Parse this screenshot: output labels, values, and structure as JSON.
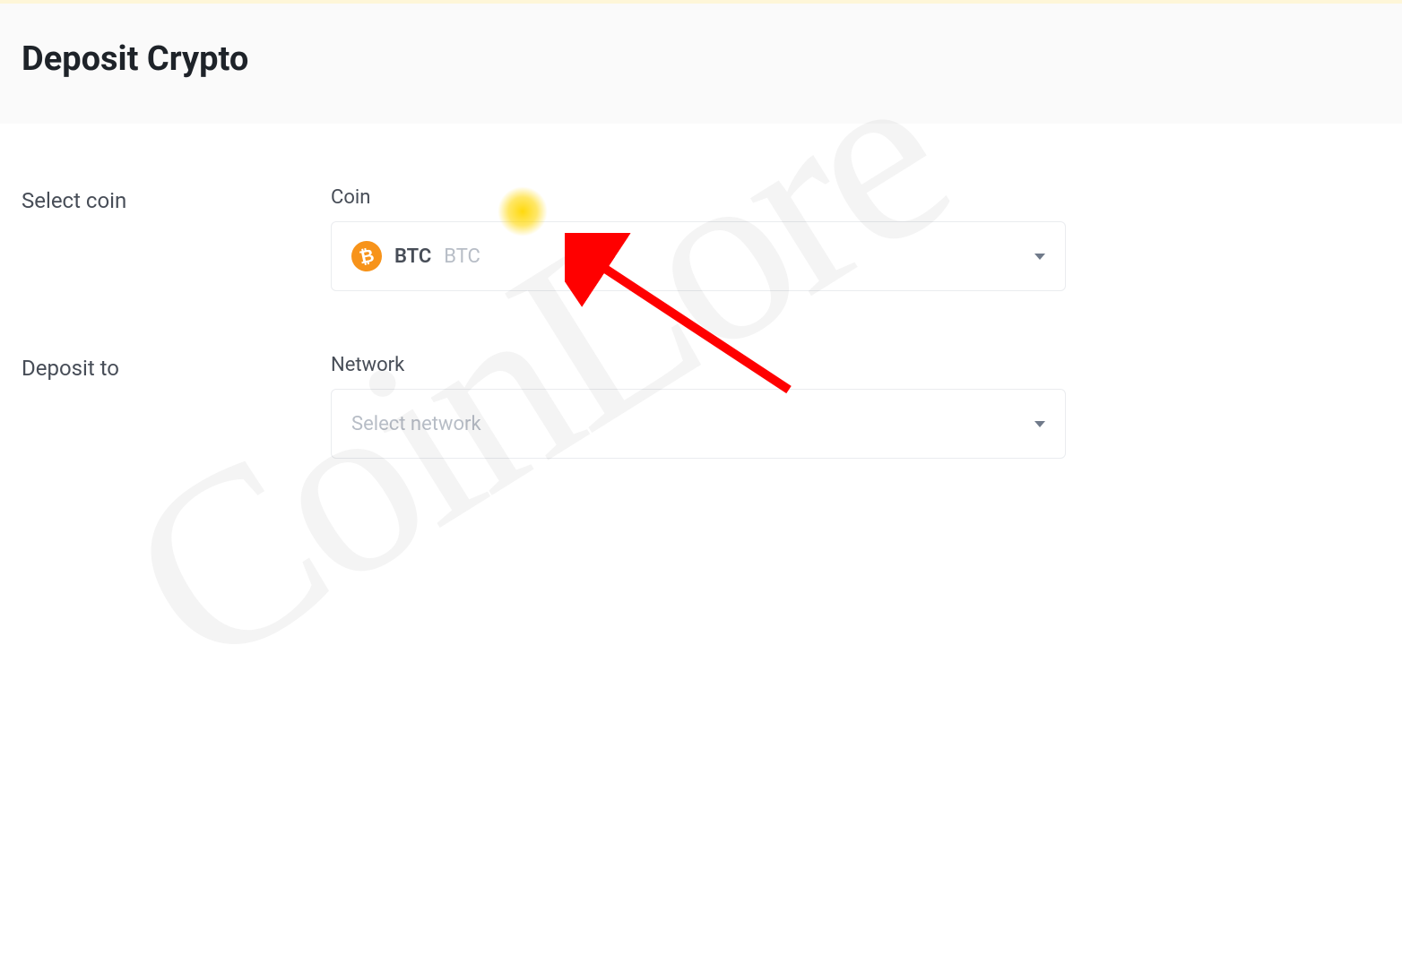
{
  "header": {
    "title": "Deposit Crypto"
  },
  "form": {
    "select_coin": {
      "row_label": "Select coin",
      "field_label": "Coin",
      "selected_symbol": "BTC",
      "selected_name": "BTC",
      "icon_glyph": "₿"
    },
    "deposit_to": {
      "row_label": "Deposit to",
      "field_label": "Network",
      "placeholder": "Select network"
    }
  },
  "watermark": "CoinLore"
}
